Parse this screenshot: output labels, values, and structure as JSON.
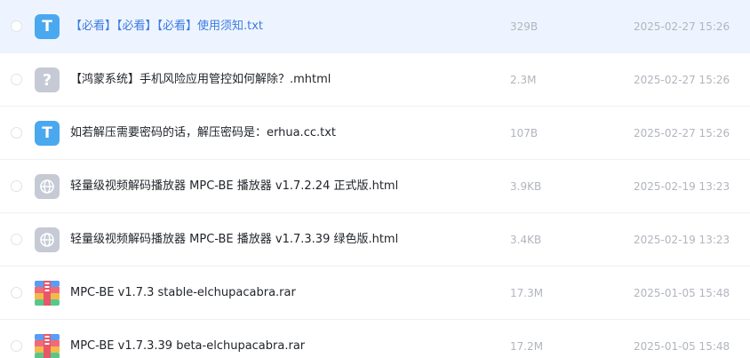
{
  "files": [
    {
      "name": "【必看】【必看】【必看】使用须知.txt",
      "size": "329B",
      "date": "2025-02-27 15:26",
      "icon": "txt-file-icon",
      "glyph": "T"
    },
    {
      "name": "【鸿蒙系统】手机风险应用管控如何解除？.mhtml",
      "size": "2.3M",
      "date": "2025-02-27 15:26",
      "icon": "unknown-file-icon",
      "glyph": "?"
    },
    {
      "name": "如若解压需要密码的话，解压密码是：erhua.cc.txt",
      "size": "107B",
      "date": "2025-02-27 15:26",
      "icon": "txt-file-icon",
      "glyph": "T"
    },
    {
      "name": "轻量级视频解码播放器 MPC-BE 播放器 v1.7.2.24 正式版.html",
      "size": "3.9KB",
      "date": "2025-02-19 13:23",
      "icon": "web-file-icon"
    },
    {
      "name": "轻量级视频解码播放器 MPC-BE 播放器 v1.7.3.39 绿色版.html",
      "size": "3.4KB",
      "date": "2025-02-19 13:23",
      "icon": "web-file-icon"
    },
    {
      "name": "MPC-BE v1.7.3 stable-elchupacabra.rar",
      "size": "17.3M",
      "date": "2025-01-05 15:48",
      "icon": "archive-file-icon"
    },
    {
      "name": "MPC-BE v1.7.3.39 beta-elchupacabra.rar",
      "size": "17.2M",
      "date": "2025-01-05 15:48",
      "icon": "archive-file-icon"
    }
  ],
  "colors": {
    "hover_bg": "#eef4ff",
    "link_blue": "#3b7ce0",
    "txt_icon": "#4aa8ef",
    "generic_icon": "#c5cad5",
    "muted_text": "#b1b5bd"
  }
}
